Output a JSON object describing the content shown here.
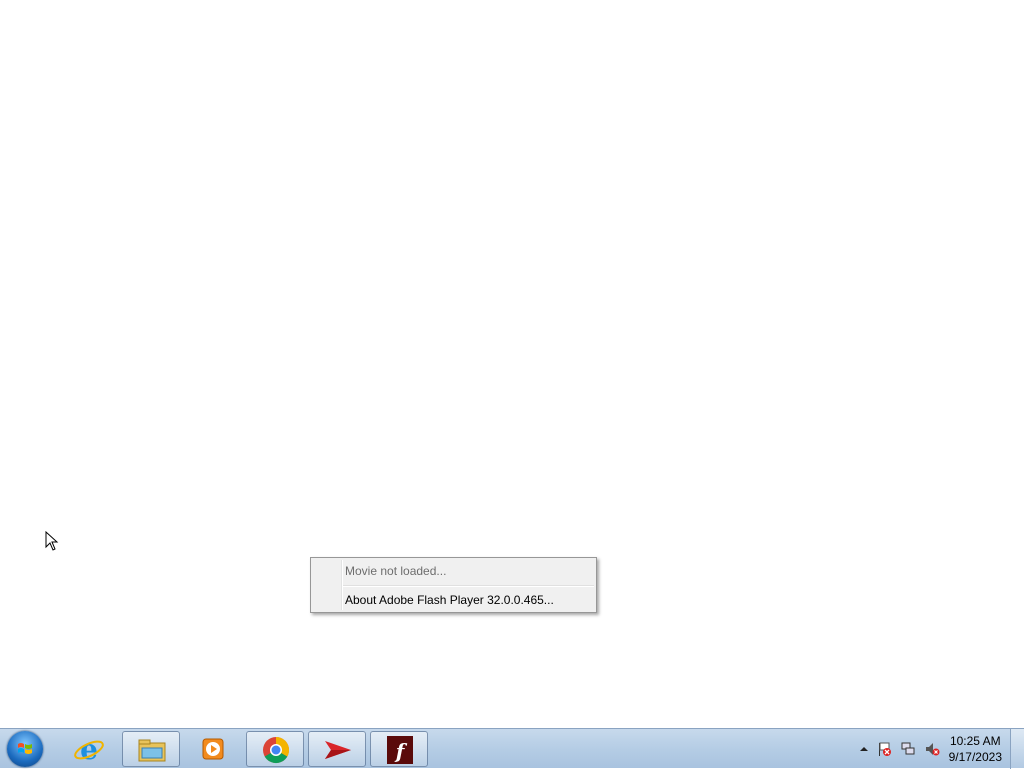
{
  "context_menu": {
    "items": [
      {
        "label": "Movie not loaded...",
        "enabled": false
      },
      {
        "label": "About Adobe Flash Player 32.0.0.465...",
        "enabled": true
      }
    ]
  },
  "taskbar": {
    "pinned": [
      {
        "name": "internet-explorer-icon",
        "active": false
      },
      {
        "name": "file-explorer-icon",
        "active": true
      },
      {
        "name": "media-player-icon",
        "active": false
      },
      {
        "name": "chrome-icon",
        "active": true
      },
      {
        "name": "red-arrow-app-icon",
        "active": true
      },
      {
        "name": "flash-player-icon",
        "active": true
      }
    ],
    "tray": {
      "icons": [
        "show-hidden-icons-arrow",
        "action-center-flag-icon",
        "network-icon",
        "volume-muted-icon"
      ],
      "time": "10:25 AM",
      "date": "9/17/2023"
    }
  },
  "colors": {
    "taskbar": "#b5cde5",
    "menu_bg": "#f0f0f0",
    "disabled_text": "#6d6d6d"
  }
}
